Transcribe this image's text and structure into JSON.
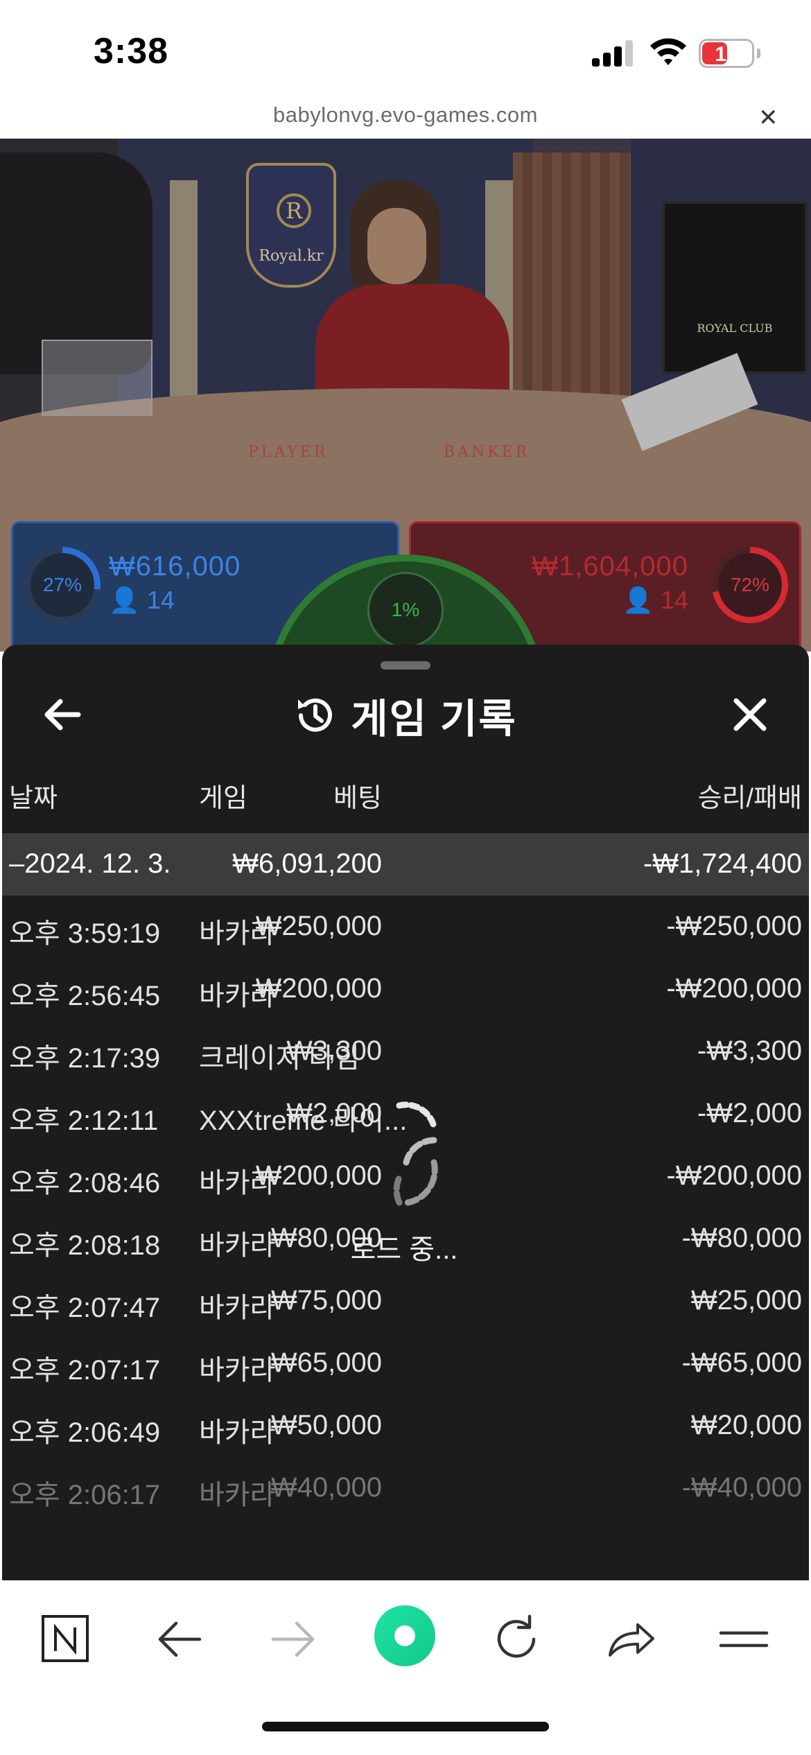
{
  "status_bar": {
    "time": "3:38",
    "battery_level": "10",
    "battery_color": "#e8333a"
  },
  "browser": {
    "url": "babylonvg.evo-games.com",
    "close_icon": "close-icon"
  },
  "video": {
    "crest_label": "Royal.kr",
    "crest_letter": "R",
    "table_player": "PLAYER",
    "table_banker": "BANKER",
    "sign_text": "ROYAL CLUB",
    "player_percent": "27%",
    "player_amount": "₩616,000",
    "player_count": "14",
    "banker_percent": "72%",
    "banker_amount": "₩1,604,000",
    "banker_count": "14",
    "tie_percent": "1%"
  },
  "history": {
    "title": "게임 기록",
    "columns": {
      "date": "날짜",
      "game": "게임",
      "bet": "베팅",
      "win_loss": "승리/패배"
    },
    "summary": {
      "date": "–2024. 12. 3.",
      "bet": "₩6,091,200",
      "win_loss": "-₩1,724,400"
    },
    "rows": [
      {
        "time": "오후 3:59:19",
        "game": "바카라",
        "bet": "₩250,000",
        "win_loss": "-₩250,000"
      },
      {
        "time": "오후 2:56:45",
        "game": "바카라",
        "bet": "₩200,000",
        "win_loss": "-₩200,000"
      },
      {
        "time": "오후 2:17:39",
        "game": "크레이지 타임",
        "bet": "₩3,300",
        "win_loss": "-₩3,300"
      },
      {
        "time": "오후 2:12:11",
        "game": "XXXtreme 라이...",
        "bet": "₩2,000",
        "win_loss": "-₩2,000"
      },
      {
        "time": "오후 2:08:46",
        "game": "바카라",
        "bet": "₩200,000",
        "win_loss": "-₩200,000"
      },
      {
        "time": "오후 2:08:18",
        "game": "바카라",
        "bet": "₩80,000",
        "win_loss": "-₩80,000"
      },
      {
        "time": "오후 2:07:47",
        "game": "바카라",
        "bet": "₩75,000",
        "win_loss": "₩25,000"
      },
      {
        "time": "오후 2:07:17",
        "game": "바카라",
        "bet": "₩65,000",
        "win_loss": "-₩65,000"
      },
      {
        "time": "오후 2:06:49",
        "game": "바카라",
        "bet": "₩50,000",
        "win_loss": "₩20,000"
      },
      {
        "time": "오후 2:06:17",
        "game": "바카라",
        "bet": "₩40,000",
        "win_loss": "-₩40,000"
      }
    ],
    "loading_text": "로드 중..."
  },
  "toolbar": {
    "items": [
      "n-home-icon",
      "back-arrow-icon",
      "forward-arrow-icon",
      "green-dot-icon",
      "refresh-icon",
      "share-icon",
      "menu-icon"
    ],
    "accent": "#1de3a4"
  }
}
